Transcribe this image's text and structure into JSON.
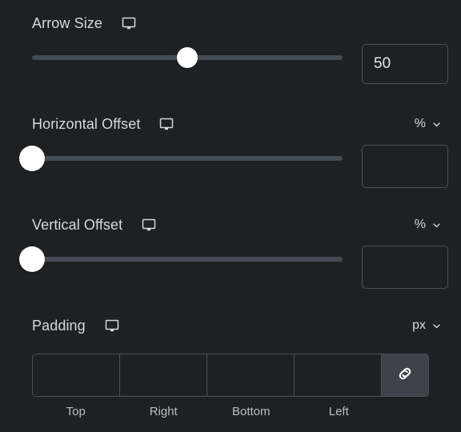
{
  "panel": {
    "background_color": "#1e2124",
    "accent_color": "#ffffff",
    "border_color": "#4b5159",
    "track_color": "#454b54",
    "label_color": "#d6d9dd"
  },
  "controls": {
    "arrow_size": {
      "label": "Arrow Size",
      "device_icon": "monitor-icon",
      "slider": {
        "value": 50,
        "min": 0,
        "max": 100,
        "handle_percent": 50
      },
      "input": {
        "value": "50",
        "placeholder": ""
      }
    },
    "horizontal_offset": {
      "label": "Horizontal Offset",
      "device_icon": "monitor-icon",
      "unit": {
        "value": "%",
        "chevron_icon": "chevron-down-icon"
      },
      "slider": {
        "value": 0,
        "min": 0,
        "max": 100,
        "handle_percent": 0
      },
      "input": {
        "value": "",
        "placeholder": ""
      }
    },
    "vertical_offset": {
      "label": "Vertical Offset",
      "device_icon": "monitor-icon",
      "unit": {
        "value": "%",
        "chevron_icon": "chevron-down-icon"
      },
      "slider": {
        "value": 0,
        "min": 0,
        "max": 100,
        "handle_percent": 0
      },
      "input": {
        "value": "",
        "placeholder": ""
      }
    },
    "padding": {
      "label": "Padding",
      "device_icon": "monitor-icon",
      "unit": {
        "value": "px",
        "chevron_icon": "chevron-down-icon"
      },
      "link_icon": "link-icon",
      "fields": [
        {
          "label": "Top",
          "value": "",
          "placeholder": ""
        },
        {
          "label": "Right",
          "value": "",
          "placeholder": ""
        },
        {
          "label": "Bottom",
          "value": "",
          "placeholder": ""
        },
        {
          "label": "Left",
          "value": "",
          "placeholder": ""
        }
      ]
    }
  }
}
